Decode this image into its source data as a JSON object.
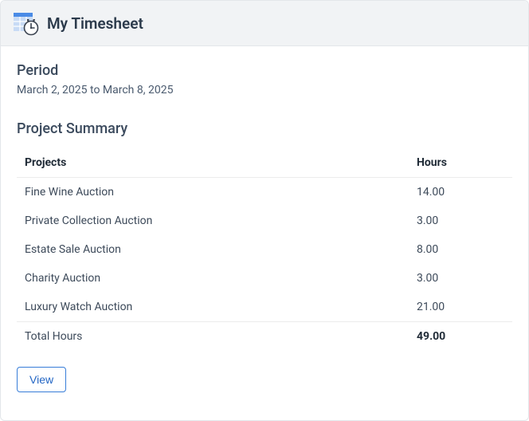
{
  "header": {
    "title": "My Timesheet"
  },
  "period": {
    "label": "Period",
    "value": "March 2, 2025 to March 8, 2025"
  },
  "summary": {
    "title": "Project Summary",
    "columns": {
      "projects": "Projects",
      "hours": "Hours"
    },
    "rows": [
      {
        "project": "Fine Wine Auction",
        "hours": "14.00"
      },
      {
        "project": "Private Collection Auction",
        "hours": "3.00"
      },
      {
        "project": "Estate Sale Auction",
        "hours": "8.00"
      },
      {
        "project": "Charity Auction",
        "hours": "3.00"
      },
      {
        "project": "Luxury Watch Auction",
        "hours": "21.00"
      }
    ],
    "total": {
      "label": "Total Hours",
      "hours": "49.00"
    }
  },
  "actions": {
    "view": "View"
  },
  "colors": {
    "accent": "#3b78d6",
    "header_text": "#2b3a4b"
  }
}
